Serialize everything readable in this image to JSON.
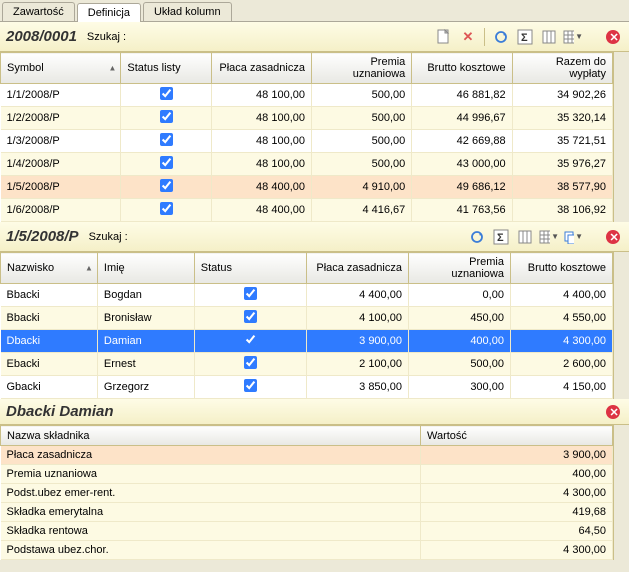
{
  "tabs": {
    "items": [
      "Zawartość",
      "Definicja",
      "Układ kolumn"
    ],
    "active": 1
  },
  "panel1": {
    "title": "2008/0001",
    "search_label": "Szukaj  :",
    "columns": [
      "Symbol",
      "Status listy",
      "Płaca zasadnicza",
      "Premia uznaniowa",
      "Brutto kosztowe",
      "Razem do wypłaty"
    ],
    "rows": [
      {
        "symbol": "1/1/2008/P",
        "status": true,
        "placa": "48 100,00",
        "premia": "500,00",
        "brutto": "46 881,82",
        "razem": "34 902,26"
      },
      {
        "symbol": "1/2/2008/P",
        "status": true,
        "placa": "48 100,00",
        "premia": "500,00",
        "brutto": "44 996,67",
        "razem": "35 320,14"
      },
      {
        "symbol": "1/3/2008/P",
        "status": true,
        "placa": "48 100,00",
        "premia": "500,00",
        "brutto": "42 669,88",
        "razem": "35 721,51"
      },
      {
        "symbol": "1/4/2008/P",
        "status": true,
        "placa": "48 100,00",
        "premia": "500,00",
        "brutto": "43 000,00",
        "razem": "35 976,27"
      },
      {
        "symbol": "1/5/2008/P",
        "status": true,
        "placa": "48 400,00",
        "premia": "4 910,00",
        "brutto": "49 686,12",
        "razem": "38 577,90",
        "highlight": true
      },
      {
        "symbol": "1/6/2008/P",
        "status": true,
        "placa": "48 400,00",
        "premia": "4 416,67",
        "brutto": "41 763,56",
        "razem": "38 106,92"
      }
    ]
  },
  "panel2": {
    "title": "1/5/2008/P",
    "search_label": "Szukaj  :",
    "columns": [
      "Nazwisko",
      "Imię",
      "Status",
      "Płaca zasadnicza",
      "Premia uznaniowa",
      "Brutto kosztowe"
    ],
    "rows": [
      {
        "nazwisko": "Bbacki",
        "imie": "Bogdan",
        "status": true,
        "placa": "4 400,00",
        "premia": "0,00",
        "brutto": "4 400,00"
      },
      {
        "nazwisko": "Bbacki",
        "imie": "Bronisław",
        "status": true,
        "placa": "4 100,00",
        "premia": "450,00",
        "brutto": "4 550,00"
      },
      {
        "nazwisko": "Dbacki",
        "imie": "Damian",
        "status": true,
        "placa": "3 900,00",
        "premia": "400,00",
        "brutto": "4 300,00",
        "selected": true
      },
      {
        "nazwisko": "Ebacki",
        "imie": "Ernest",
        "status": true,
        "placa": "2 100,00",
        "premia": "500,00",
        "brutto": "2 600,00"
      },
      {
        "nazwisko": "Gbacki",
        "imie": "Grzegorz",
        "status": true,
        "placa": "3 850,00",
        "premia": "300,00",
        "brutto": "4 150,00"
      }
    ]
  },
  "panel3": {
    "title": "Dbacki Damian",
    "columns": [
      "Nazwa składnika",
      "Wartość"
    ],
    "rows": [
      {
        "name": "Płaca zasadnicza",
        "value": "3 900,00",
        "hl": true
      },
      {
        "name": "Premia uznaniowa",
        "value": "400,00"
      },
      {
        "name": "Podst.ubez emer-rent.",
        "value": "4 300,00"
      },
      {
        "name": "Składka emerytalna",
        "value": "419,68"
      },
      {
        "name": "Składka rentowa",
        "value": "64,50"
      },
      {
        "name": "Podstawa ubez.chor.",
        "value": "4 300,00"
      }
    ]
  }
}
